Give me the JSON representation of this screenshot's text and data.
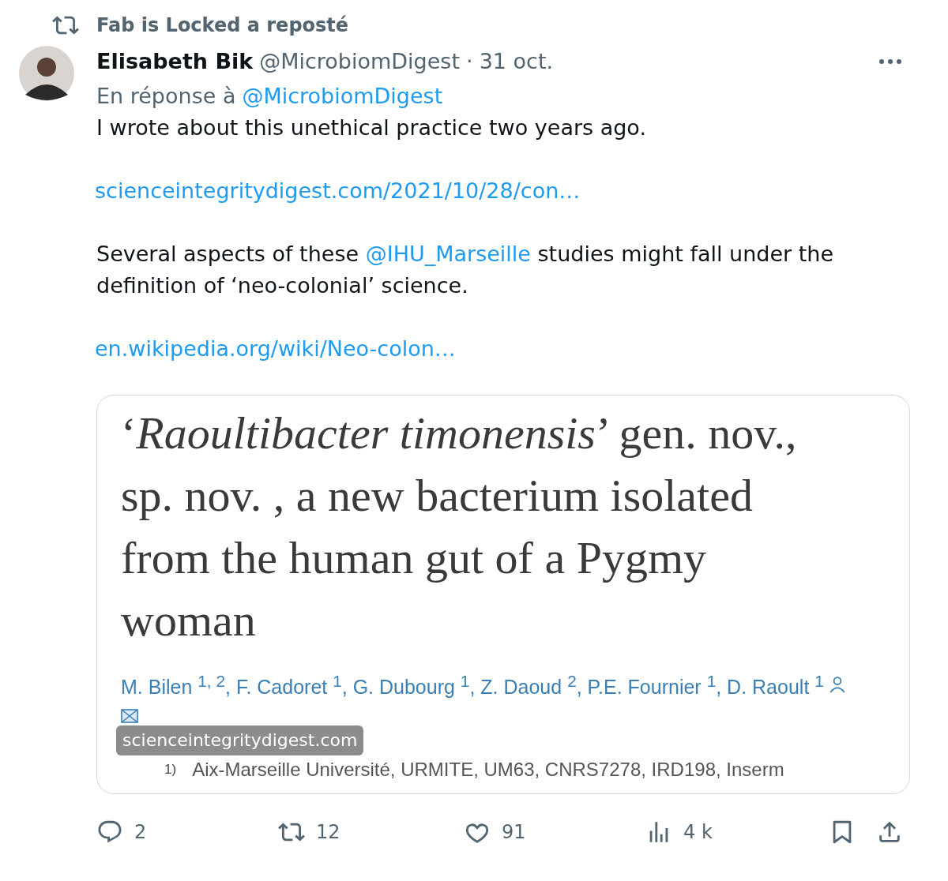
{
  "repost_banner": "Fab is Locked a reposté",
  "author": {
    "name": "Elisabeth Bik",
    "handle": "@MicrobiomDigest",
    "separator": "·",
    "date": "31 oct."
  },
  "reply_to": {
    "prefix": "En réponse à",
    "mention": "@MicrobiomDigest"
  },
  "body": [
    {
      "kind": "text",
      "parts": [
        {
          "kind": "plain",
          "text": "I wrote about this unethical practice two years ago."
        }
      ]
    },
    {
      "kind": "link",
      "parts": [
        {
          "kind": "link",
          "text": "scienceintegritydigest.com/2021/10/28/con…"
        }
      ]
    },
    {
      "kind": "text",
      "parts": [
        {
          "kind": "plain",
          "text": "Several aspects of these "
        },
        {
          "kind": "mention",
          "text": "@IHU_Marseille"
        },
        {
          "kind": "plain",
          "text": " studies might fall under the definition of ‘neo-colonial’ science."
        }
      ]
    },
    {
      "kind": "link",
      "parts": [
        {
          "kind": "link",
          "text": "en.wikipedia.org/wiki/Neo-colon…"
        }
      ]
    }
  ],
  "card": {
    "article_title": "‘*Raoultibacter timonensis*’ gen. nov., sp. nov. , a new bacterium isolated from the human gut of a Pygmy woman",
    "authors": "M. Bilen $^{1, 2}$, F. Cadoret $^{1}$, G. Dubourg $^{1}$, Z. Daoud $^{2}$, P.E. Fournier $^{1}$, D. Raoult $^{1}$",
    "affiliation_mark": "1)",
    "affiliation": "Aix-Marseille Université, URMITE, UM63, CNRS7278, IRD198, Inserm",
    "domain": "scienceintegritydigest.com"
  },
  "actions": [
    {
      "kind": "reply",
      "count": "2"
    },
    {
      "kind": "repost",
      "count": "12"
    },
    {
      "kind": "like",
      "count": "91"
    },
    {
      "kind": "views",
      "count": "4 k"
    },
    {
      "kind": "bookmark"
    },
    {
      "kind": "share"
    }
  ]
}
